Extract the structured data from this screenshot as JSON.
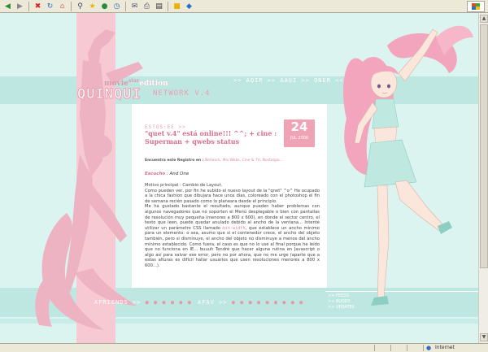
{
  "browser": {
    "toolbar_icons": [
      "back-icon",
      "forward-icon",
      "stop-icon",
      "refresh-icon",
      "home-icon",
      "search-icon",
      "favorites-icon",
      "media-icon",
      "history-icon",
      "mail-icon",
      "print-icon",
      "edit-icon",
      "discuss-icon",
      "messenger-icon"
    ],
    "status_zone": "Internet"
  },
  "site": {
    "movie": "movie",
    "star": "star",
    "edition": "edition",
    "logo": "QUINQUI",
    "network": "NETWORK V.4",
    "top_nav": ">> AQIR >> AAUI >> ONER << DSM",
    "bottom_left": "AFRIENDS >>",
    "bottom_mid": "AFAV >>",
    "dots_left": "● ● ● ● ● ●",
    "dots_mid": "● ● ● ● ● ● ● ● ●",
    "right_links": [
      ">> FEEDS",
      ">> BUDDY",
      ">> UPDATES"
    ]
  },
  "post": {
    "pretitle": "ESTOS:EE >>",
    "title": "\"quet v.4\" está online!!! ^^; + cine : Superman + qwebs status",
    "day": "24",
    "month": "JUL 2006",
    "filed_label": "Encuentra este Registro en :",
    "filed_cats": "Network, Mis Webs, Cine & TV, Nostalgia....",
    "listen_label": "Escucho",
    "listen_value": ": And One",
    "body": [
      "Motivo principal : Cambio de Layout.",
      "Como pueden ver, por fin he subido el nuevo layout de la \"qnet\" ^o^ He ocupado a la chica fashion que dibujara hace unos días, coloreado con el photoshop el fin de semana recién pasado como lo planeara desde el principio.",
      "Me ha gustado bastante el resultado, aunque pueden haber problemas con algunos navegadores que no soporten el Menú desplegable o bien con pantallas de resolución muy pequeña (menores a 800 x 600), en donde el sector centro, el texto que leen, puede quedar anulado debido al ancho de la ventana... Intenté utilizar un parámetro CSS llamado",
      "min-width",
      ", que establece un ancho mínimo para un elemento: o sea, asumo que si el contenedor crece, el ancho del objeto también, pero si disminuye, el ancho del objeto no disminuye a menos del ancho mínimo establecido. Como fuera, el caso es que no lo usé al final porque he leído que no funciona en IE... buuuh Tendré que hacer alguna rutina en Javascript o algo así para salvar ese error, pero no por ahora, que no me urge (aparte que a estas alturas es difícil hallar usuarios que usen resoluciones menores a 800 x 600...)."
    ]
  }
}
